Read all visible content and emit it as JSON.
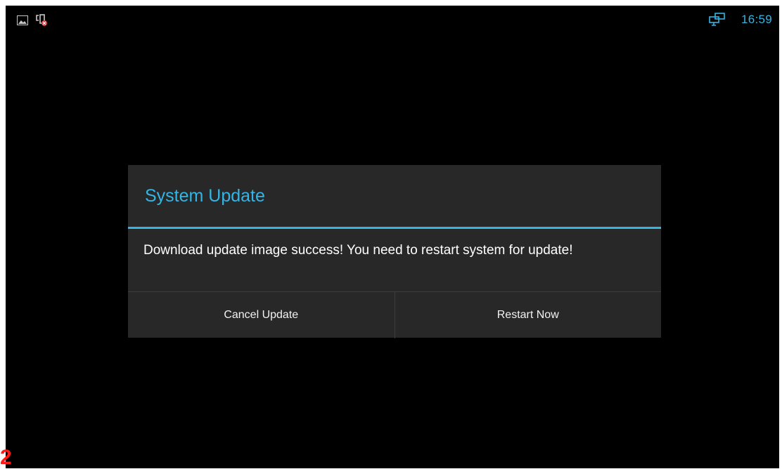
{
  "status_bar": {
    "left_icons": [
      "gallery-icon",
      "usb-debug-icon"
    ],
    "right_icons": [
      "network-icon"
    ],
    "time": "16:59",
    "accent_color": "#33b5e5"
  },
  "dialog": {
    "title": "System Update",
    "message": "Download update image success! You need to restart system for update!",
    "buttons": {
      "cancel": "Cancel Update",
      "restart": "Restart Now"
    }
  },
  "corner_mark": "2"
}
